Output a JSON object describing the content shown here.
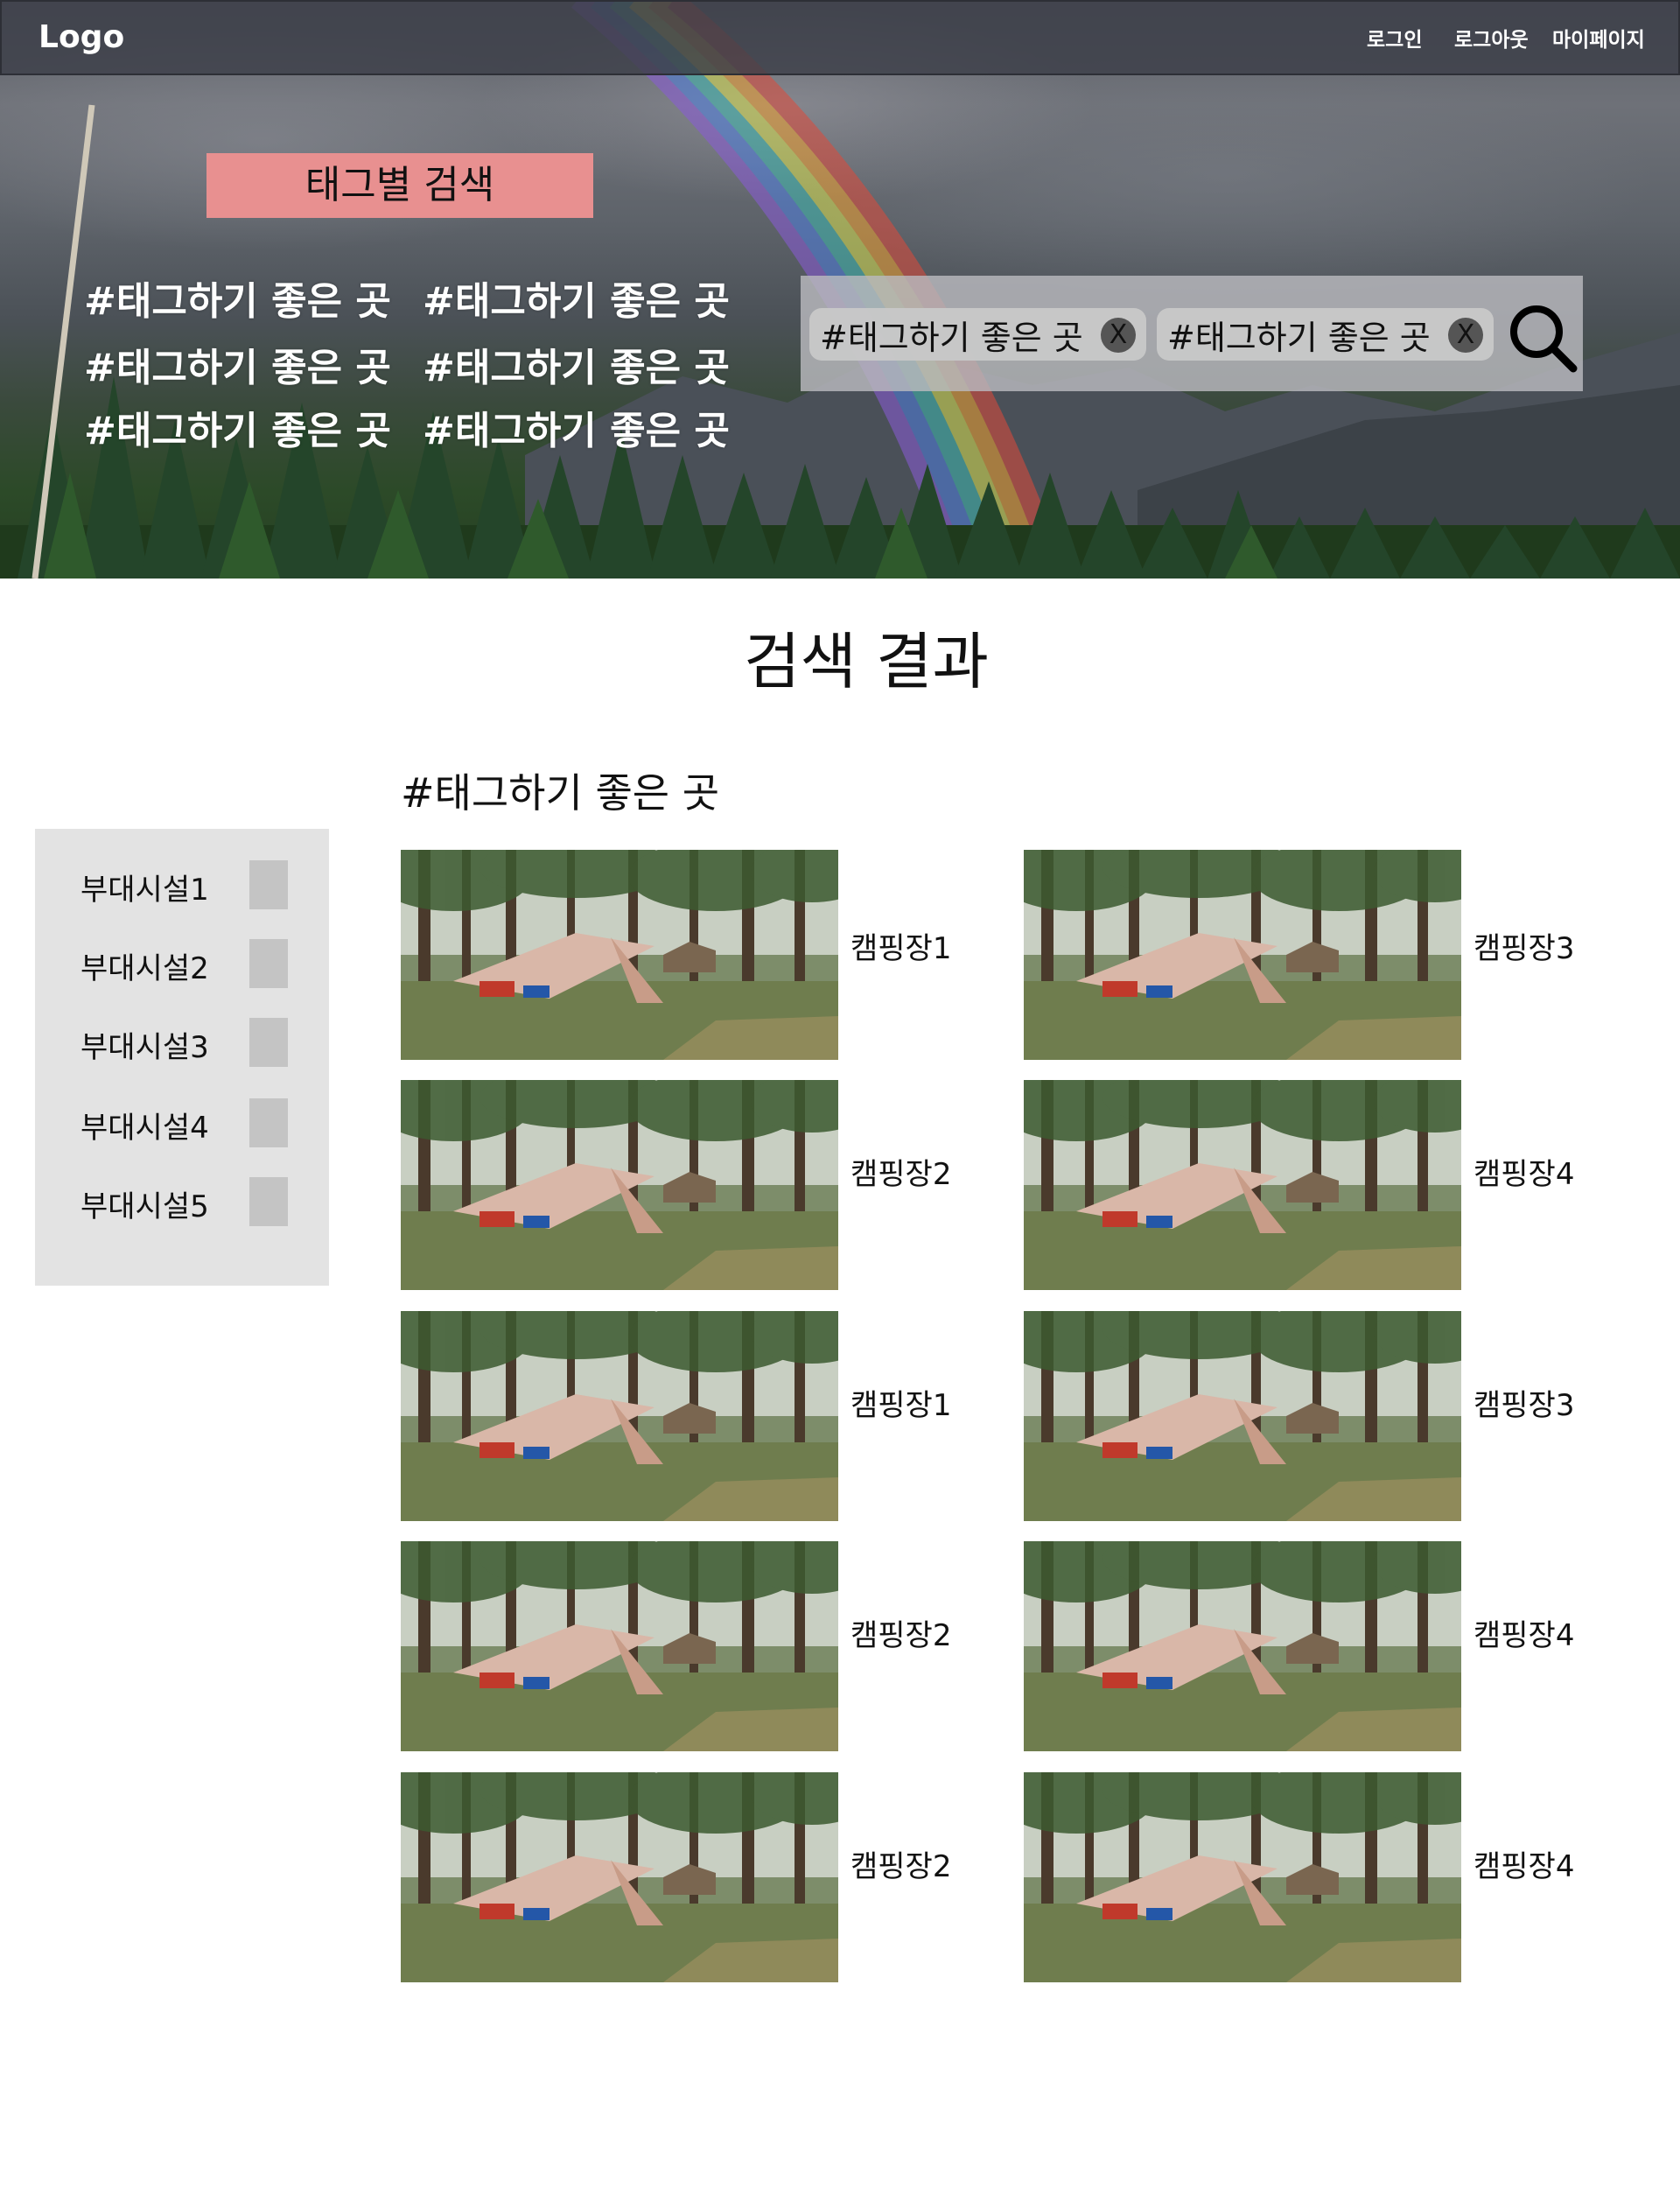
{
  "nav": {
    "logo": "Logo",
    "login": "로그인",
    "logout": "로그아웃",
    "mypage": "마이페이지"
  },
  "hero": {
    "tag_search_label": "태그별 검색",
    "tags": [
      "#태그하기 좋은 곳",
      "#태그하기 좋은 곳",
      "#태그하기 좋은 곳",
      "#태그하기 좋은 곳",
      "#태그하기 좋은 곳",
      "#태그하기 좋은 곳"
    ],
    "selected_tags": [
      {
        "label": "#태그하기 좋은 곳",
        "remove": "X"
      },
      {
        "label": "#태그하기 좋은 곳",
        "remove": "X"
      }
    ]
  },
  "results": {
    "title": "검색 결과",
    "tag": "#태그하기 좋은 곳",
    "cards": [
      "캠핑장1",
      "캠핑장3",
      "캠핑장2",
      "캠핑장4",
      "캠핑장1",
      "캠핑장3",
      "캠핑장2",
      "캠핑장4",
      "캠핑장2",
      "캠핑장4"
    ]
  },
  "facilities": [
    "부대시설1",
    "부대시설2",
    "부대시설3",
    "부대시설4",
    "부대시설5"
  ],
  "colors": {
    "tag_label_bg": "#e89090",
    "sidebar_bg": "#e3e3e3",
    "checkbox": "#c4c4c4",
    "search_box": "#b9b9be"
  }
}
